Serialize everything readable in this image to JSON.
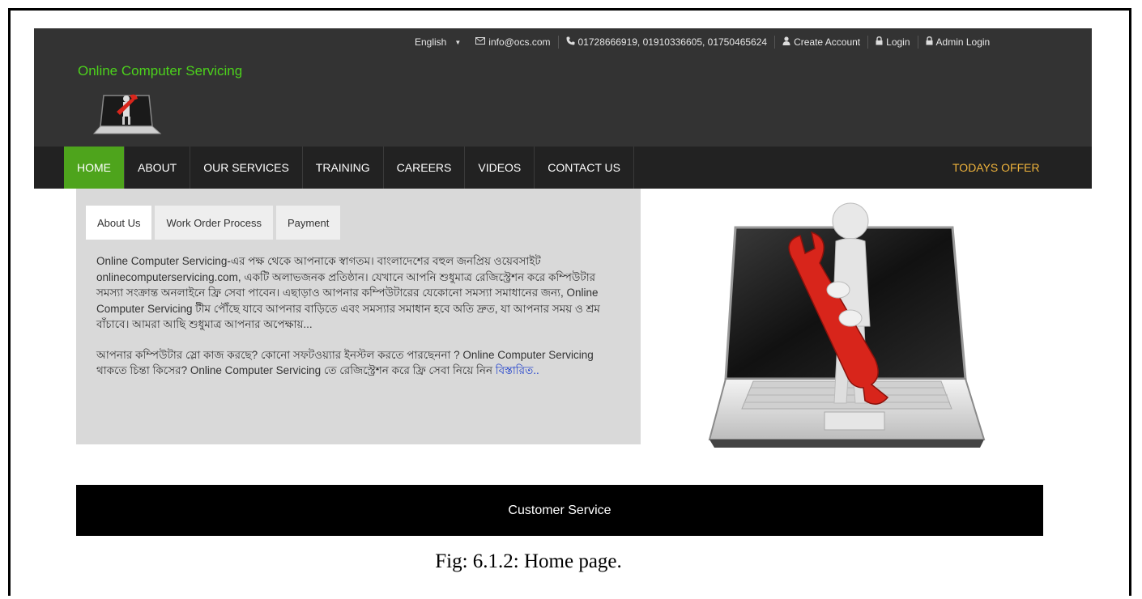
{
  "topbar": {
    "language": "English",
    "language_caret": "▼",
    "email": "info@ocs.com",
    "phones": "01728666919, 01910336605, 01750465624",
    "create_account": "Create Account",
    "login": "Login",
    "admin_login": "Admin Login"
  },
  "brand": {
    "title": "Online Computer Servicing"
  },
  "nav": {
    "items": [
      "HOME",
      "ABOUT",
      "OUR SERVICES",
      "TRAINING",
      "CAREERS",
      "VIDEOS",
      "CONTACT US"
    ],
    "offer": "TODAYS OFFER",
    "active_color": "#4ea41c",
    "offer_color": "#f0b43c"
  },
  "tabs": [
    "About Us",
    "Work Order Process",
    "Payment"
  ],
  "about": {
    "para1": "Online Computer Servicing-এর পক্ষ থেকে আপনাকে স্বাগতম। বাংলাদেশের বহুল জনপ্রিয় ওয়েবসাইট onlinecomputerservicing.com, একটি অলাভজনক প্রতিষ্ঠান। যেখানে আপনি শুধুমাত্র রেজিস্ট্রেশন করে কম্পিউটার সমস্যা সংক্রান্ত অনলাইনে ফ্রি সেবা পাবেন। এছাড়াও আপনার কম্পিউটারের যেকোনো সমস্যা সমাধানের জন্য, Online Computer Servicing টীম পৌঁছে যাবে আপনার বাড়িতে এবং সমস্যার সমাধান হবে অতি দ্রুত, যা আপনার সময় ও শ্রম বাঁচাবে। আমরা আছি শুধুমাত্র আপনার অপেক্ষায়...",
    "para2": "আপনার কম্পিউটার স্লো কাজ করছে? কোনো সফটওয়্যার ইনস্টল করতে পারছেননা ? Online Computer Servicing থাকতে চিন্তা কিসের? Online Computer Servicing তে রেজিস্ট্রেশন করে ফ্রি সেবা নিয়ে নিন ",
    "more_link": "বিস্তারিত.."
  },
  "customer_service": "Customer Service",
  "caption": "Fig: 6.1.2: Home page.",
  "icons": {
    "email": "envelope-icon",
    "phone": "phone-icon",
    "user": "user-icon",
    "lock": "lock-icon"
  }
}
